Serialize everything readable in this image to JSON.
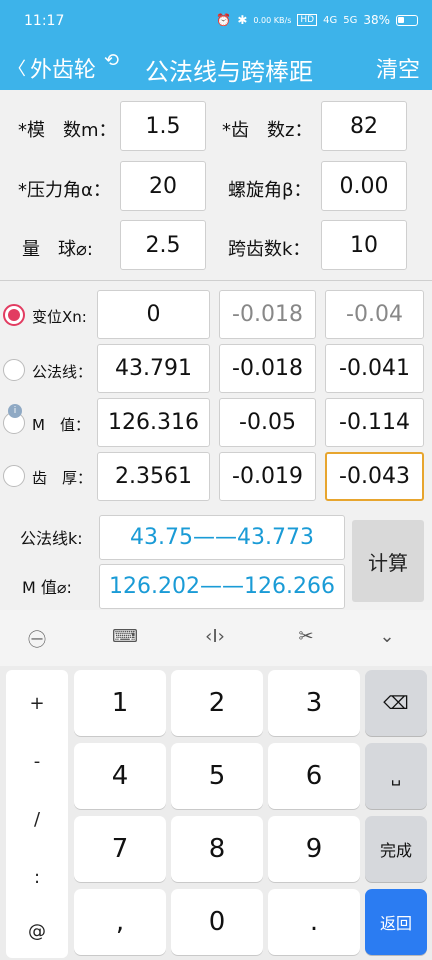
{
  "status": {
    "time": "11:17",
    "net": "0.00 KB/s",
    "hd": "HD",
    "sig1": "4G",
    "sig2": "5G",
    "battery": "38%"
  },
  "header": {
    "back_label": "外齿轮",
    "title": "公法线与跨棒距",
    "clear_label": "清空"
  },
  "params": {
    "modulus_label": "*模　数m：",
    "modulus": "1.5",
    "teeth_label": "*齿　数z：",
    "teeth": "82",
    "pressure_label": "*压力角α：",
    "pressure": "20",
    "helix_label": "螺旋角β：",
    "helix": "0.00",
    "ball_label": "量　球⌀:",
    "ball": "2.5",
    "span_label": "跨齿数k：",
    "span": "10"
  },
  "rows": [
    {
      "label": "变位Xn:",
      "v1": "0",
      "v2": "-0.018",
      "v3": "-0.04"
    },
    {
      "label": "公法线：",
      "v1": "43.791",
      "v2": "-0.018",
      "v3": "-0.041"
    },
    {
      "label": "M　值：",
      "v1": "126.316",
      "v2": "-0.05",
      "v3": "-0.114"
    },
    {
      "label": "齿　厚：",
      "v1": "2.3561",
      "v2": "-0.019",
      "v3": "-0.043"
    }
  ],
  "results": {
    "wk_label": "公法线k:",
    "wk_range": "43.75——43.773",
    "m_label": "M 值⌀:",
    "m_range": "126.202——126.266",
    "calc_label": "计算"
  },
  "keyboard": {
    "symbols": [
      "+",
      "-",
      "/",
      ":",
      "@"
    ],
    "digits": [
      "1",
      "2",
      "3",
      "4",
      "5",
      "6",
      "7",
      "8",
      "9",
      ",",
      "0",
      "."
    ],
    "done_label": "完成",
    "return_label": "返回"
  },
  "colors": {
    "accent": "#3db3ea",
    "radio": "#e23c61",
    "result": "#1a9bd6",
    "enter": "#2b7cf2",
    "focus": "#e7a52e"
  }
}
